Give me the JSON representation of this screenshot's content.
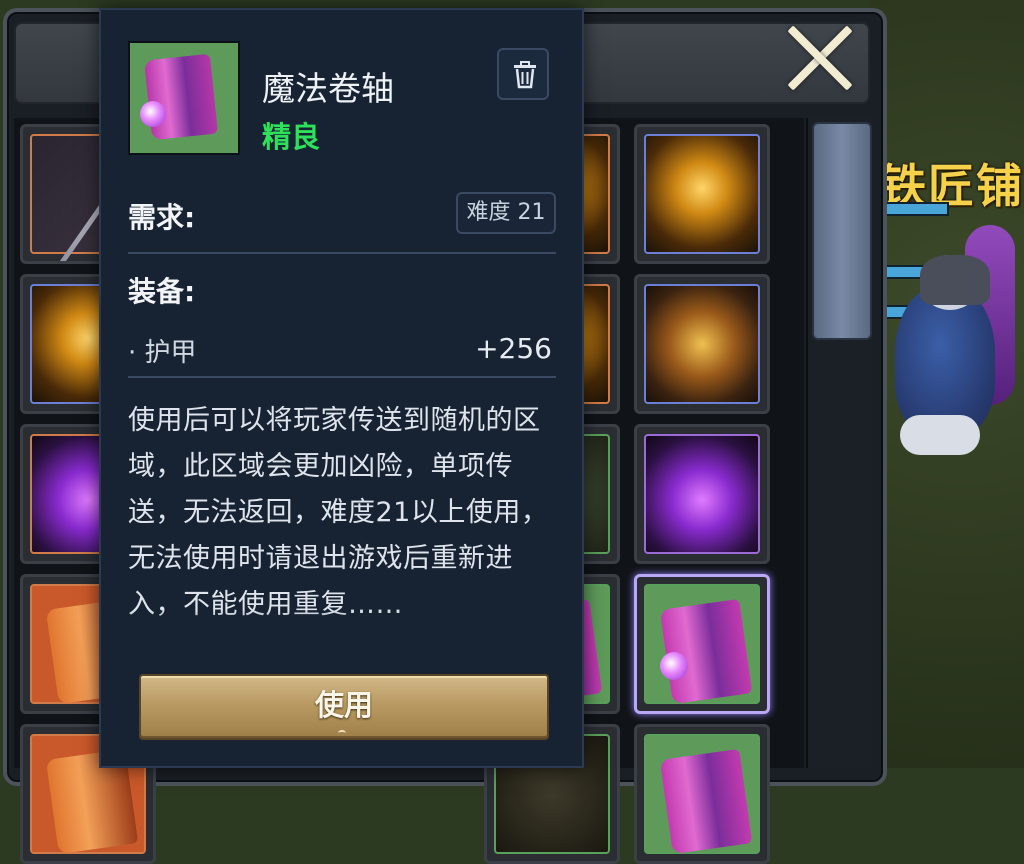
{
  "world": {
    "shop_sign": "铁匠铺"
  },
  "inventory": {
    "close_icon": "close-x-icon"
  },
  "tooltip": {
    "item_name": "魔法卷轴",
    "quality": "精良",
    "quality_color": "#2ee05a",
    "requirement_label": "需求:",
    "requirement_badge": "难度 21",
    "equip_label": "装备:",
    "stat_name": "· 护甲",
    "stat_value": "+256",
    "description": "使用后可以将玩家传送到随机的区域，此区域会更加凶险，单项传送，无法返回，难度21以上使用，无法使用时请退出游戏后重新进入，不能使用重复……",
    "use_button_label": "使用",
    "trash_icon": "trash-icon"
  }
}
